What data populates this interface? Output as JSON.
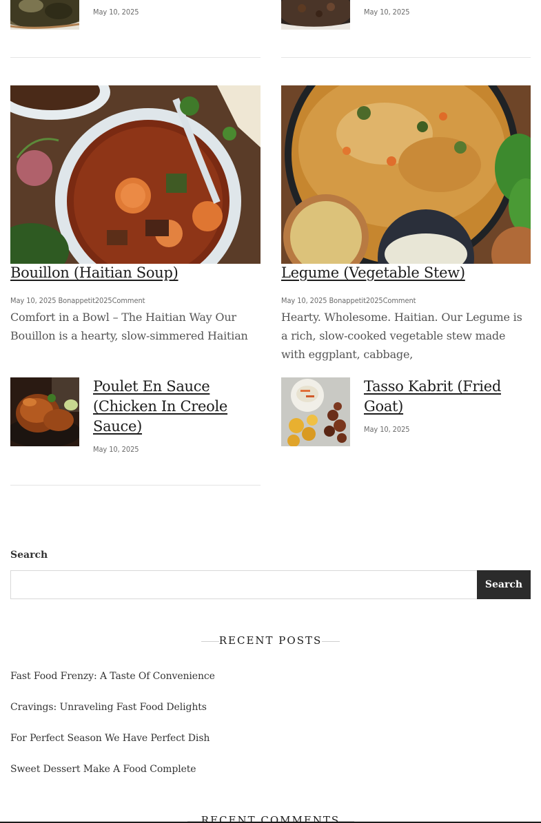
{
  "top_row": [
    {
      "date": "May 10, 2025"
    },
    {
      "date": "May 10, 2025"
    }
  ],
  "featured": [
    {
      "title": "Bouillon (Haitian Soup)",
      "meta": "May 10, 2025 Bonappetit2025Comment",
      "excerpt": "Comfort in a Bowl – The Haitian Way Our Bouillon is a hearty, slow-simmered Haitian"
    },
    {
      "title": "Legume (Vegetable Stew)",
      "meta": "May 10, 2025 Bonappetit2025Comment",
      "excerpt": "Hearty. Wholesome. Haitian. Our Legume is a rich, slow-cooked vegetable stew made with eggplant, cabbage,"
    }
  ],
  "small_posts": [
    {
      "title": "Poulet En Sauce (Chicken In Creole Sauce)",
      "date": "May 10, 2025"
    },
    {
      "title": "Tasso Kabrit (Fried Goat)",
      "date": "May 10, 2025"
    }
  ],
  "search": {
    "label": "Search",
    "placeholder": "",
    "button_label": "Search"
  },
  "recent_posts": {
    "heading": "RECENT POSTS",
    "items": [
      "Fast Food Frenzy: A Taste Of Convenience",
      "Cravings: Unraveling Fast Food Delights",
      "For Perfect Season We Have Perfect Dish",
      "Sweet Dessert Make A Food Complete"
    ]
  },
  "recent_comments": {
    "heading": "RECENT COMMENTS"
  }
}
